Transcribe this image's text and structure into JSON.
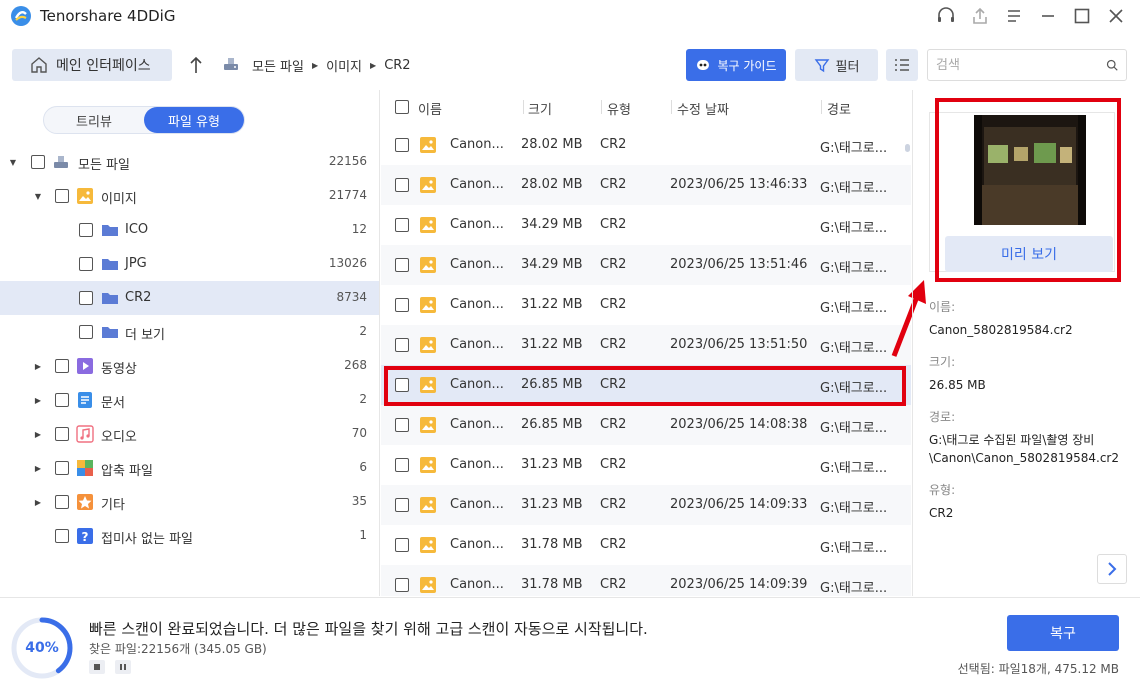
{
  "app": {
    "title": "Tenorshare 4DDiG"
  },
  "toolbar": {
    "home_label": "메인 인터페이스",
    "breadcrumb": [
      "모든 파일",
      "이미지",
      "CR2"
    ],
    "guide_label": "복구 가이드",
    "filter_label": "필터",
    "search_placeholder": "검색"
  },
  "sidebar": {
    "view_tabs": [
      {
        "label": "트리뷰",
        "active": false
      },
      {
        "label": "파일 유형",
        "active": true
      }
    ],
    "tree": [
      {
        "label": "모든 파일",
        "count": "22156",
        "level": 0,
        "expanded": true,
        "icon": "drive-icon"
      },
      {
        "label": "이미지",
        "count": "21774",
        "level": 1,
        "expanded": true,
        "icon": "image-folder-icon"
      },
      {
        "label": "ICO",
        "count": "12",
        "level": 2,
        "icon": "folder-icon"
      },
      {
        "label": "JPG",
        "count": "13026",
        "level": 2,
        "icon": "folder-icon"
      },
      {
        "label": "CR2",
        "count": "8734",
        "level": 2,
        "icon": "folder-icon",
        "selected": true
      },
      {
        "label": "더 보기",
        "count": "2",
        "level": 2,
        "icon": "folder-icon"
      },
      {
        "label": "동영상",
        "count": "268",
        "level": 1,
        "expanded": false,
        "icon": "video-icon"
      },
      {
        "label": "문서",
        "count": "2",
        "level": 1,
        "expanded": false,
        "icon": "document-icon"
      },
      {
        "label": "오디오",
        "count": "70",
        "level": 1,
        "expanded": false,
        "icon": "audio-icon"
      },
      {
        "label": "압축 파일",
        "count": "6",
        "level": 1,
        "expanded": false,
        "icon": "archive-icon"
      },
      {
        "label": "기타",
        "count": "35",
        "level": 1,
        "expanded": false,
        "icon": "other-icon"
      },
      {
        "label": "접미사 없는 파일",
        "count": "1",
        "level": 1,
        "icon": "unknown-icon"
      }
    ]
  },
  "file_list": {
    "columns": [
      "이름",
      "크기",
      "유형",
      "수정 날짜",
      "경로"
    ],
    "rows": [
      {
        "name": "Canon...",
        "size": "28.02 MB",
        "type": "CR2",
        "date": "",
        "path": "G:\\태그로..."
      },
      {
        "name": "Canon...",
        "size": "28.02 MB",
        "type": "CR2",
        "date": "2023/06/25 13:46:33",
        "path": "G:\\태그로..."
      },
      {
        "name": "Canon...",
        "size": "34.29 MB",
        "type": "CR2",
        "date": "",
        "path": "G:\\태그로..."
      },
      {
        "name": "Canon...",
        "size": "34.29 MB",
        "type": "CR2",
        "date": "2023/06/25 13:51:46",
        "path": "G:\\태그로..."
      },
      {
        "name": "Canon...",
        "size": "31.22 MB",
        "type": "CR2",
        "date": "",
        "path": "G:\\태그로..."
      },
      {
        "name": "Canon...",
        "size": "31.22 MB",
        "type": "CR2",
        "date": "2023/06/25 13:51:50",
        "path": "G:\\태그로..."
      },
      {
        "name": "Canon...",
        "size": "26.85 MB",
        "type": "CR2",
        "date": "",
        "path": "G:\\태그로...",
        "selected": true
      },
      {
        "name": "Canon...",
        "size": "26.85 MB",
        "type": "CR2",
        "date": "2023/06/25 14:08:38",
        "path": "G:\\태그로..."
      },
      {
        "name": "Canon...",
        "size": "31.23 MB",
        "type": "CR2",
        "date": "",
        "path": "G:\\태그로..."
      },
      {
        "name": "Canon...",
        "size": "31.23 MB",
        "type": "CR2",
        "date": "2023/06/25 14:09:33",
        "path": "G:\\태그로..."
      },
      {
        "name": "Canon...",
        "size": "31.78 MB",
        "type": "CR2",
        "date": "",
        "path": "G:\\태그로..."
      },
      {
        "name": "Canon...",
        "size": "31.78 MB",
        "type": "CR2",
        "date": "2023/06/25 14:09:39",
        "path": "G:\\태그로..."
      }
    ]
  },
  "preview": {
    "button_label": "미리 보기",
    "name_label": "이름:",
    "name_value": "Canon_5802819584.cr2",
    "size_label": "크기:",
    "size_value": "26.85 MB",
    "path_label": "경로:",
    "path_value": "G:\\태그로 수집된 파일\\촬영 장비\\Canon\\Canon_5802819584.cr2",
    "type_label": "유형:",
    "type_value": "CR2"
  },
  "status": {
    "progress_percent": 40,
    "progress_label": "40%",
    "message": "빠른 스캔이 완료되었습니다. 더 많은 파일을 찾기 위해 고급 스캔이 자동으로 시작됩니다.",
    "found": "찾은 파일:22156개 (345.05 GB)",
    "recover_label": "복구",
    "selected_info": "선택됨: 파일18개, 475.12 MB"
  },
  "colors": {
    "accent": "#3a6ee8",
    "highlight_red": "#e1000f",
    "selection_bg": "#e3e9f6"
  }
}
